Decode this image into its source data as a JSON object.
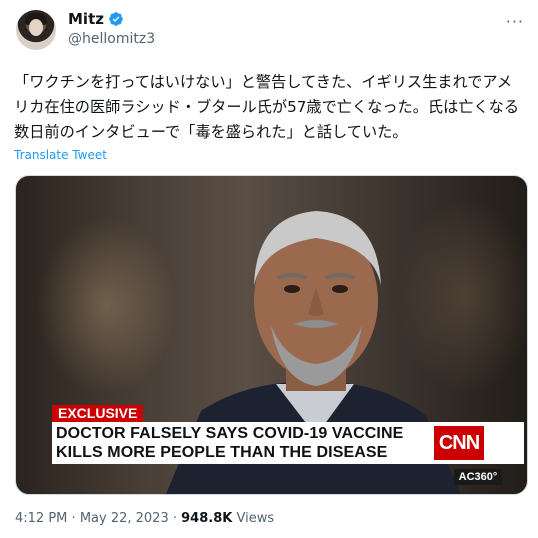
{
  "author": {
    "display_name": "Mitz",
    "handle": "@hellomitz3"
  },
  "tweet": {
    "text": "「ワクチンを打ってはいけない」と警告してきた、イギリス生まれでアメリカ在住の医師ラシッド・ブタール氏が57歳で亡くなった。氏は亡くなる数日前のインタビューで「毒を盛られた」と話していた。",
    "translate_label": "Translate Tweet"
  },
  "media": {
    "chyron_tag": "EXCLUSIVE",
    "chyron_line1": "DOCTOR FALSELY SAYS COVID-19 VACCINE",
    "chyron_line2": "KILLS MORE PEOPLE THAN THE DISEASE",
    "network_logo": "CNN",
    "show_tag": "AC360°"
  },
  "meta": {
    "time": "4:12 PM",
    "separator": "·",
    "date": "May 22, 2023",
    "views_count": "948.8K",
    "views_label": "Views"
  },
  "colors": {
    "link": "#1d9bf0",
    "verified": "#1d9bf0",
    "cnn_red": "#cc0000"
  },
  "icons": {
    "verified": "verified-badge-icon",
    "more": "more-options-icon"
  }
}
